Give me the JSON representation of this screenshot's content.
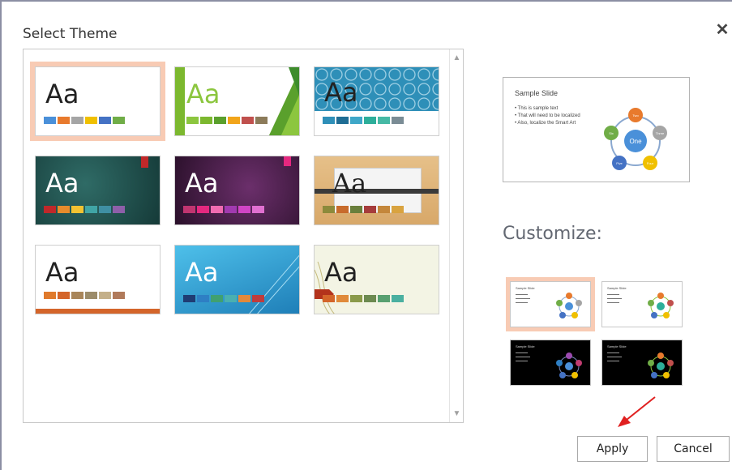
{
  "dialog": {
    "title": "Select Theme",
    "close_icon": "close-icon"
  },
  "themes": [
    {
      "aa": "Aa",
      "bg": "#ffffff",
      "aa_color": "#222222",
      "swatches": [
        "#4a90d9",
        "#e87a2d",
        "#a5a5a5",
        "#f0c000",
        "#4472c4",
        "#70ad47"
      ]
    },
    {
      "aa": "Aa",
      "bg": "#ffffff",
      "aa_color": "#8cc63f",
      "swatches": [
        "#8cc63f",
        "#7cb82f",
        "#5aa02c",
        "#f2a51a",
        "#c0504d",
        "#8c7b5a"
      ]
    },
    {
      "aa": "Aa",
      "bg": "#2e8fb8",
      "aa_color": "#222222",
      "swatches": [
        "#2e8fb8",
        "#1f6d94",
        "#3fa7c8",
        "#2dae9a",
        "#46b9a5",
        "#7a8c95"
      ]
    },
    {
      "aa": "Aa",
      "bg": "#1f4e4a",
      "aa_color": "#ffffff",
      "swatches": [
        "#c0282a",
        "#e68b2c",
        "#f2c232",
        "#40a5a5",
        "#3f8fa3",
        "#8e5fa9"
      ]
    },
    {
      "aa": "Aa",
      "bg": "#4a1f4a",
      "aa_color": "#ffffff",
      "swatches": [
        "#c03570",
        "#e4287f",
        "#f06bb1",
        "#a13ab0",
        "#d045c5",
        "#e070d0"
      ]
    },
    {
      "aa": "Aa",
      "bg": "#deb47e",
      "aa_color": "#222222",
      "swatches": [
        "#8c8a3b",
        "#c86b2c",
        "#6a7f3c",
        "#a63c3c",
        "#c4873b",
        "#d9a33f"
      ]
    },
    {
      "aa": "Aa",
      "bg": "#ffffff",
      "aa_color": "#222222",
      "swatches": [
        "#e07a2c",
        "#d4652a",
        "#a9865a",
        "#9c8c6a",
        "#c4b08a",
        "#b07a5a"
      ]
    },
    {
      "aa": "Aa",
      "bg": "#2f9fd4",
      "aa_color": "#ffffff",
      "swatches": [
        "#1f3c73",
        "#2e7fc4",
        "#40a070",
        "#4ab0b0",
        "#e2893a",
        "#c03c3c"
      ]
    },
    {
      "aa": "Aa",
      "bg": "#f3f4e4",
      "aa_color": "#222222",
      "swatches": [
        "#d4652a",
        "#e08a3a",
        "#8a9a4a",
        "#6c8a50",
        "#58a070",
        "#4ab0a0"
      ]
    }
  ],
  "preview": {
    "title": "Sample Slide",
    "bullets": [
      "• This is sample text",
      "• That will need to be localized",
      "• Also, localize the Smart Art"
    ],
    "smartart": {
      "center": "One",
      "nodes": [
        "Two",
        "Three",
        "Four",
        "Five",
        "Six"
      ]
    }
  },
  "customize": {
    "label": "Customize:"
  },
  "variants": [
    {
      "title": "Sample Slide",
      "bg": "#ffffff",
      "fg": "#444444",
      "selected": true
    },
    {
      "title": "Sample Slide",
      "bg": "#ffffff",
      "fg": "#444444",
      "selected": false
    },
    {
      "title": "Sample Slide",
      "bg": "#000000",
      "fg": "#dddddd",
      "selected": false
    },
    {
      "title": "Sample Slide",
      "bg": "#000000",
      "fg": "#dddddd",
      "selected": false
    }
  ],
  "buttons": {
    "apply": "Apply",
    "cancel": "Cancel"
  },
  "colors": {
    "selection": "#f8cbb4",
    "annotation_arrow": "#e02020"
  }
}
